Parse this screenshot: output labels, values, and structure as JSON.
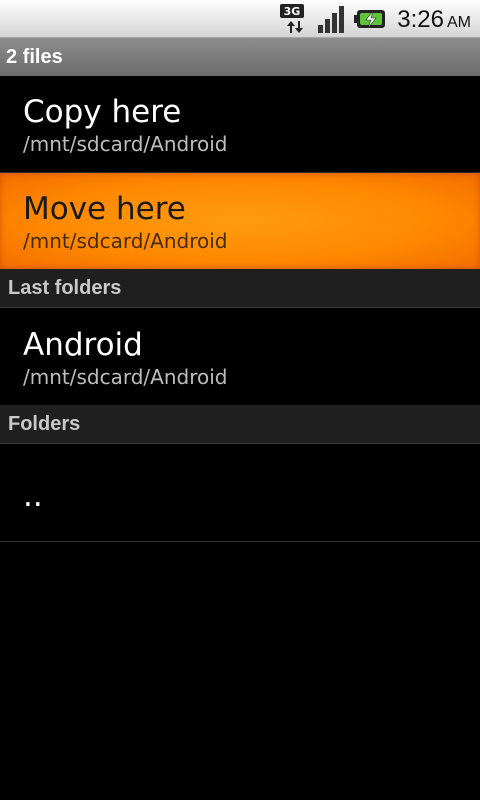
{
  "status_bar": {
    "network_icon": "3g-data-icon",
    "signal_icon": "signal-strength-icon",
    "battery_icon": "battery-charging-icon",
    "time": "3:26",
    "ampm": "AM"
  },
  "header": {
    "title": "2 files"
  },
  "actions": [
    {
      "label": "Copy here",
      "path": "/mnt/sdcard/Android"
    },
    {
      "label": "Move here",
      "path": "/mnt/sdcard/Android",
      "selected": true
    }
  ],
  "sections": {
    "last_folders": "Last folders",
    "folders": "Folders"
  },
  "last_folders": [
    {
      "name": "Android",
      "path": "/mnt/sdcard/Android"
    }
  ],
  "folders": [
    {
      "name": ".."
    }
  ],
  "colors": {
    "highlight": "#ff8a00",
    "background": "#000000",
    "section_bg": "#1f1f1f"
  }
}
